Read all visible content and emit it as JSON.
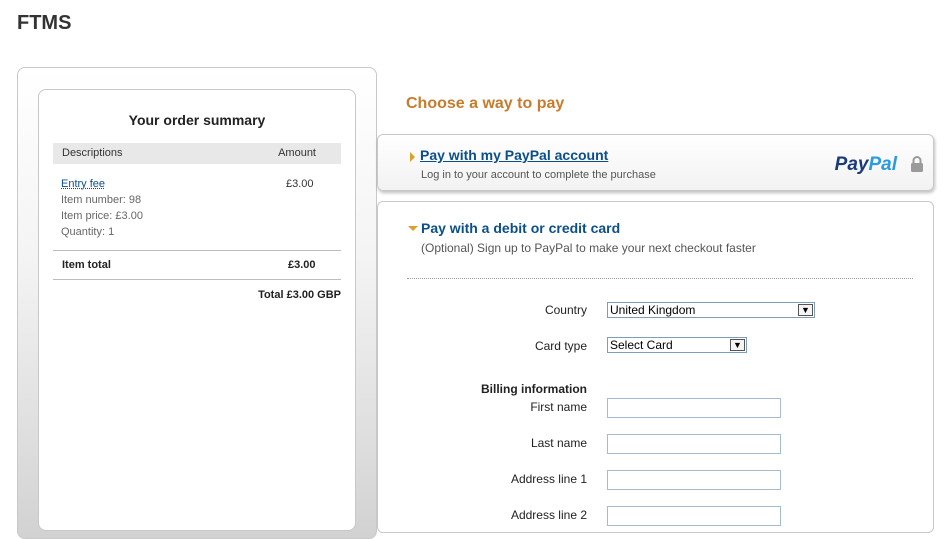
{
  "merchant": {
    "name": "FTMS"
  },
  "summary": {
    "title": "Your order summary",
    "col_desc": "Descriptions",
    "col_amount": "Amount",
    "item": {
      "name": "Entry fee",
      "amount": "£3.00",
      "number": "Item number: 98",
      "price": "Item price: £3.00",
      "quantity": "Quantity: 1"
    },
    "item_total_label": "Item total",
    "item_total": "£3.00",
    "grand_total": "Total £3.00 GBP"
  },
  "choose_title": "Choose a way to pay",
  "paypal_option": {
    "title": "Pay with my PayPal account",
    "subtitle": "Log in to your account to complete the purchase",
    "logo_a": "Pay",
    "logo_b": "Pal"
  },
  "card_option": {
    "title": "Pay with a debit or credit card",
    "subtitle": "(Optional) Sign up to PayPal to make your next checkout faster"
  },
  "form": {
    "country_label": "Country",
    "country_value": "United Kingdom",
    "card_type_label": "Card type",
    "card_type_value": "Select Card",
    "billing_heading": "Billing information",
    "first_name_label": "First name",
    "last_name_label": "Last name",
    "address1_label": "Address line 1",
    "address2_label": "Address line 2"
  },
  "colors": {
    "accent": "#c77c2d",
    "link": "#0b4f8a",
    "arrow": "#d8a328"
  },
  "icons": {
    "lock": "lock-icon",
    "dropdown": "chevron-down-icon"
  }
}
